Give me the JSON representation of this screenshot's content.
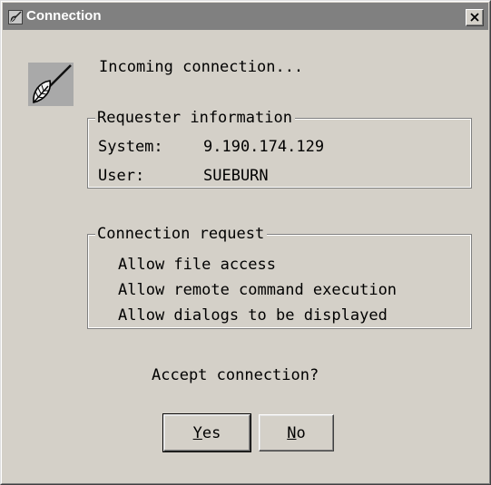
{
  "window": {
    "title": "Connection",
    "close_symbol": "X"
  },
  "icons": {
    "title_icon": "quill-leaf-icon",
    "app_icon": "quill-leaf-icon",
    "close_icon": "close-icon"
  },
  "message": {
    "incoming": "Incoming connection..."
  },
  "requester": {
    "group_label": "Requester information",
    "system_label": "System:",
    "system_value": "9.190.174.129",
    "user_label": "User:",
    "user_value": "SUEBURN"
  },
  "request": {
    "group_label": "Connection request",
    "items": [
      "Allow file access",
      "Allow remote command execution",
      "Allow dialogs to be displayed"
    ]
  },
  "prompt": {
    "question": "Accept connection?"
  },
  "buttons": {
    "yes": {
      "accel": "Y",
      "rest": "es"
    },
    "no": {
      "accel": "N",
      "rest": "o"
    }
  },
  "colors": {
    "dialog_bg": "#d4d0c8",
    "titlebar_bg": "#808080",
    "titlebar_text": "#ffffff"
  }
}
